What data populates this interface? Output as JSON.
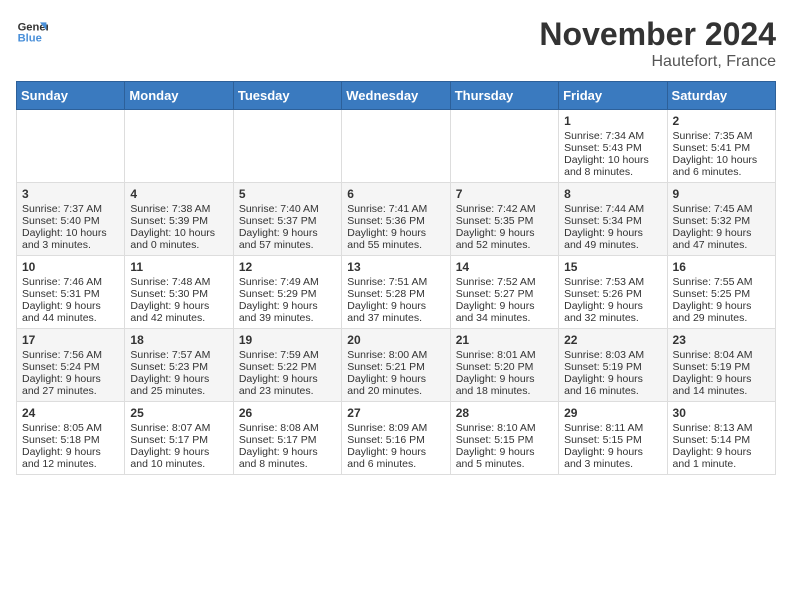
{
  "header": {
    "logo_line1": "General",
    "logo_line2": "Blue",
    "month_title": "November 2024",
    "location": "Hautefort, France"
  },
  "weekdays": [
    "Sunday",
    "Monday",
    "Tuesday",
    "Wednesday",
    "Thursday",
    "Friday",
    "Saturday"
  ],
  "weeks": [
    [
      {
        "day": "",
        "info": ""
      },
      {
        "day": "",
        "info": ""
      },
      {
        "day": "",
        "info": ""
      },
      {
        "day": "",
        "info": ""
      },
      {
        "day": "",
        "info": ""
      },
      {
        "day": "1",
        "info": "Sunrise: 7:34 AM\nSunset: 5:43 PM\nDaylight: 10 hours and 8 minutes."
      },
      {
        "day": "2",
        "info": "Sunrise: 7:35 AM\nSunset: 5:41 PM\nDaylight: 10 hours and 6 minutes."
      }
    ],
    [
      {
        "day": "3",
        "info": "Sunrise: 7:37 AM\nSunset: 5:40 PM\nDaylight: 10 hours and 3 minutes."
      },
      {
        "day": "4",
        "info": "Sunrise: 7:38 AM\nSunset: 5:39 PM\nDaylight: 10 hours and 0 minutes."
      },
      {
        "day": "5",
        "info": "Sunrise: 7:40 AM\nSunset: 5:37 PM\nDaylight: 9 hours and 57 minutes."
      },
      {
        "day": "6",
        "info": "Sunrise: 7:41 AM\nSunset: 5:36 PM\nDaylight: 9 hours and 55 minutes."
      },
      {
        "day": "7",
        "info": "Sunrise: 7:42 AM\nSunset: 5:35 PM\nDaylight: 9 hours and 52 minutes."
      },
      {
        "day": "8",
        "info": "Sunrise: 7:44 AM\nSunset: 5:34 PM\nDaylight: 9 hours and 49 minutes."
      },
      {
        "day": "9",
        "info": "Sunrise: 7:45 AM\nSunset: 5:32 PM\nDaylight: 9 hours and 47 minutes."
      }
    ],
    [
      {
        "day": "10",
        "info": "Sunrise: 7:46 AM\nSunset: 5:31 PM\nDaylight: 9 hours and 44 minutes."
      },
      {
        "day": "11",
        "info": "Sunrise: 7:48 AM\nSunset: 5:30 PM\nDaylight: 9 hours and 42 minutes."
      },
      {
        "day": "12",
        "info": "Sunrise: 7:49 AM\nSunset: 5:29 PM\nDaylight: 9 hours and 39 minutes."
      },
      {
        "day": "13",
        "info": "Sunrise: 7:51 AM\nSunset: 5:28 PM\nDaylight: 9 hours and 37 minutes."
      },
      {
        "day": "14",
        "info": "Sunrise: 7:52 AM\nSunset: 5:27 PM\nDaylight: 9 hours and 34 minutes."
      },
      {
        "day": "15",
        "info": "Sunrise: 7:53 AM\nSunset: 5:26 PM\nDaylight: 9 hours and 32 minutes."
      },
      {
        "day": "16",
        "info": "Sunrise: 7:55 AM\nSunset: 5:25 PM\nDaylight: 9 hours and 29 minutes."
      }
    ],
    [
      {
        "day": "17",
        "info": "Sunrise: 7:56 AM\nSunset: 5:24 PM\nDaylight: 9 hours and 27 minutes."
      },
      {
        "day": "18",
        "info": "Sunrise: 7:57 AM\nSunset: 5:23 PM\nDaylight: 9 hours and 25 minutes."
      },
      {
        "day": "19",
        "info": "Sunrise: 7:59 AM\nSunset: 5:22 PM\nDaylight: 9 hours and 23 minutes."
      },
      {
        "day": "20",
        "info": "Sunrise: 8:00 AM\nSunset: 5:21 PM\nDaylight: 9 hours and 20 minutes."
      },
      {
        "day": "21",
        "info": "Sunrise: 8:01 AM\nSunset: 5:20 PM\nDaylight: 9 hours and 18 minutes."
      },
      {
        "day": "22",
        "info": "Sunrise: 8:03 AM\nSunset: 5:19 PM\nDaylight: 9 hours and 16 minutes."
      },
      {
        "day": "23",
        "info": "Sunrise: 8:04 AM\nSunset: 5:19 PM\nDaylight: 9 hours and 14 minutes."
      }
    ],
    [
      {
        "day": "24",
        "info": "Sunrise: 8:05 AM\nSunset: 5:18 PM\nDaylight: 9 hours and 12 minutes."
      },
      {
        "day": "25",
        "info": "Sunrise: 8:07 AM\nSunset: 5:17 PM\nDaylight: 9 hours and 10 minutes."
      },
      {
        "day": "26",
        "info": "Sunrise: 8:08 AM\nSunset: 5:17 PM\nDaylight: 9 hours and 8 minutes."
      },
      {
        "day": "27",
        "info": "Sunrise: 8:09 AM\nSunset: 5:16 PM\nDaylight: 9 hours and 6 minutes."
      },
      {
        "day": "28",
        "info": "Sunrise: 8:10 AM\nSunset: 5:15 PM\nDaylight: 9 hours and 5 minutes."
      },
      {
        "day": "29",
        "info": "Sunrise: 8:11 AM\nSunset: 5:15 PM\nDaylight: 9 hours and 3 minutes."
      },
      {
        "day": "30",
        "info": "Sunrise: 8:13 AM\nSunset: 5:14 PM\nDaylight: 9 hours and 1 minute."
      }
    ]
  ]
}
